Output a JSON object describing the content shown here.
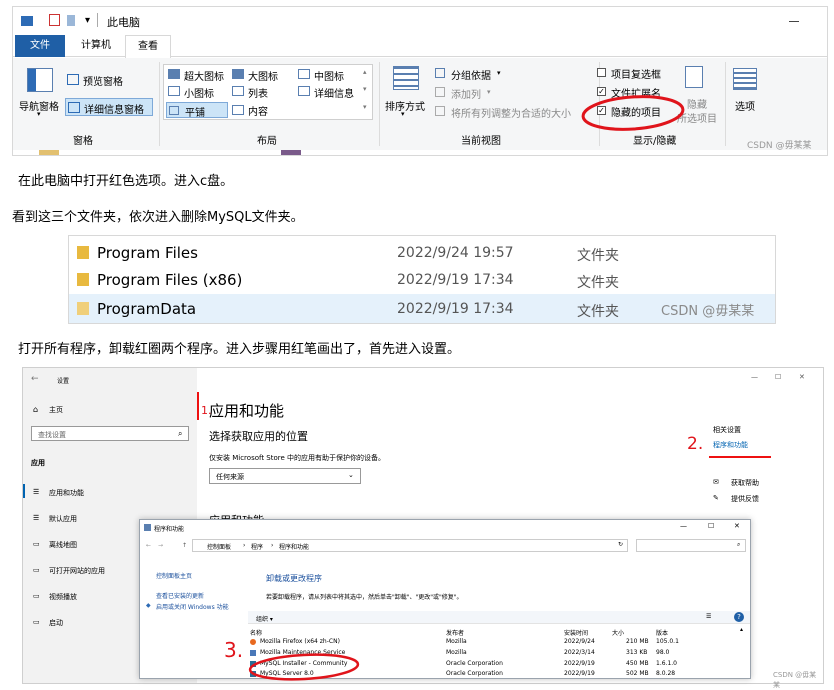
{
  "ribbon": {
    "title": "此电脑",
    "tabs": [
      "文件",
      "计算机",
      "查看"
    ],
    "panes": {
      "nav_pane": "导航窗格",
      "preview": "预览窗格",
      "details": "详细信息窗格",
      "group": "窗格"
    },
    "layout": {
      "items": [
        "超大图标",
        "大图标",
        "中图标",
        "小图标",
        "列表",
        "详细信息",
        "平铺",
        "内容"
      ],
      "group": "布局"
    },
    "current_view": {
      "sort": "排序方式",
      "group_by": "分组依据",
      "add_column": "添加列",
      "fit_columns": "将所有列调整为合适的大小",
      "group": "当前视图"
    },
    "show_hide": {
      "item_checkboxes": "项目复选框",
      "file_ext": "文件扩展名",
      "hidden_items": "隐藏的项目",
      "hide": "隐藏",
      "selected_items": "所选项目",
      "group": "显示/隐藏"
    },
    "options": "选项",
    "watermark": "CSDN @毋某某"
  },
  "captions": {
    "c1": "在此电脑中打开红色选项。进入c盘。",
    "c2": "看到这三个文件夹，依次进入删除MySQL文件夹。",
    "c3": "打开所有程序，卸载红圈两个程序。进入步骤用红笔画出了，首先进入设置。"
  },
  "folders": {
    "rows": [
      {
        "name": "Program Files",
        "date": "2022/9/24 19:57",
        "type": "文件夹"
      },
      {
        "name": "Program Files (x86)",
        "date": "2022/9/19 17:34",
        "type": "文件夹"
      },
      {
        "name": "ProgramData",
        "date": "2022/9/19 17:34",
        "type": "文件夹"
      }
    ],
    "watermark": "CSDN @毋某某"
  },
  "settings": {
    "title": "设置",
    "home": "主页",
    "search_placeholder": "查找设置",
    "section": "应用",
    "nav": [
      "应用和功能",
      "默认应用",
      "离线地图",
      "可打开网站的应用",
      "视频播放",
      "启动"
    ],
    "heading": "应用和功能",
    "subheading": "选择获取应用的位置",
    "desc": "仅安装 Microsoft Store 中的应用有助于保护你的设备。",
    "dropdown": "任何来源",
    "section2": "应用和功能",
    "related": "相关设置",
    "related_link": "程序和功能",
    "help": "获取帮助",
    "feedback": "提供反馈",
    "annot1": "1.",
    "annot2": "2."
  },
  "programs": {
    "title": "程序和功能",
    "breadcrumb": [
      "控制面板",
      "程序",
      "程序和功能"
    ],
    "left_links": [
      "控制面板主页",
      "查看已安装的更新",
      "启用或关闭 Windows 功能"
    ],
    "heading": "卸载或更改程序",
    "desc": "若要卸载程序，请从列表中将其选中，然后单击\"卸载\"、\"更改\"或\"修复\"。",
    "organize": "组织 ▾",
    "columns": [
      "名称",
      "发布者",
      "安装时间",
      "大小",
      "版本"
    ],
    "rows": [
      {
        "name": "Mozilla Firefox (x64 zh-CN)",
        "publisher": "Mozilla",
        "date": "2022/9/24",
        "size": "210 MB",
        "version": "105.0.1"
      },
      {
        "name": "Mozilla Maintenance Service",
        "publisher": "Mozilla",
        "date": "2022/3/14",
        "size": "313 KB",
        "version": "98.0"
      },
      {
        "name": "MySQL Installer - Community",
        "publisher": "Oracle Corporation",
        "date": "2022/9/19",
        "size": "450 MB",
        "version": "1.6.1.0"
      },
      {
        "name": "MySQL Server 8.0",
        "publisher": "Oracle Corporation",
        "date": "2022/9/19",
        "size": "502 MB",
        "version": "8.0.28"
      }
    ],
    "annot3": "3.",
    "watermark": "CSDN @毋某某"
  }
}
